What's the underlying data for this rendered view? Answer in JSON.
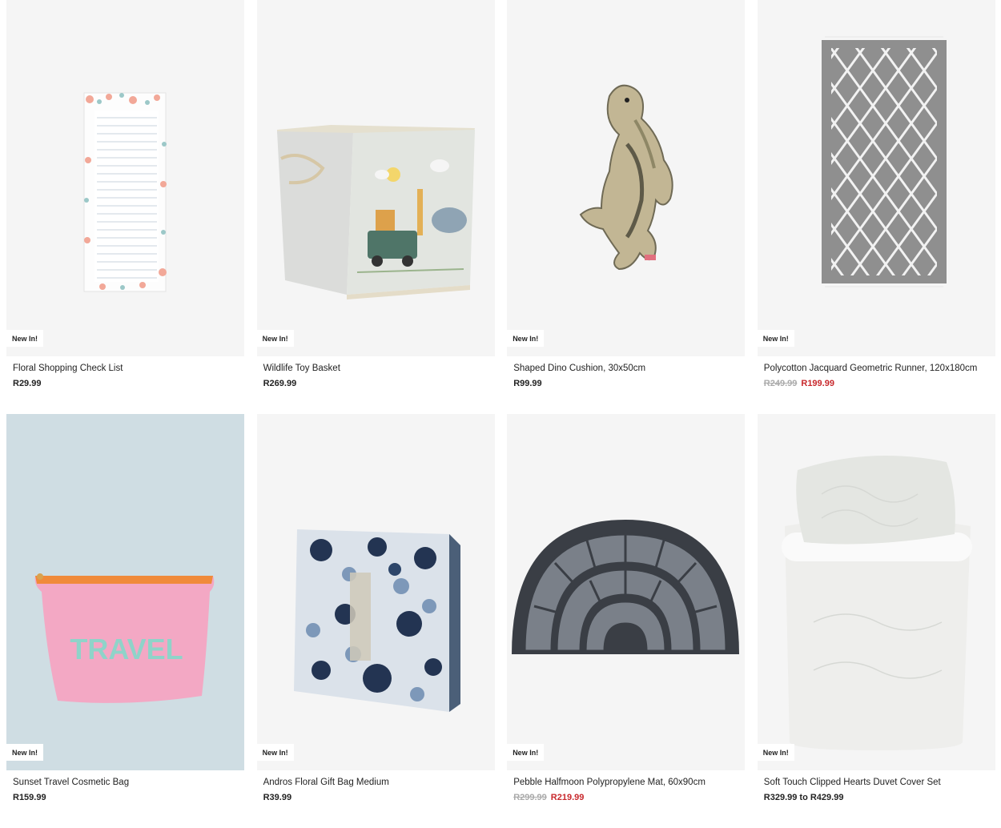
{
  "products": [
    {
      "name": "Floral Shopping Check List",
      "badge": "New In!",
      "price": "R29.99",
      "was": "",
      "now": "",
      "image": "floral-checklist-image",
      "bg": "#f5f5f5"
    },
    {
      "name": "Wildlife Toy Basket",
      "badge": "New In!",
      "price": "R269.99",
      "was": "",
      "now": "",
      "image": "toy-basket-image",
      "bg": "#f5f5f5"
    },
    {
      "name": "Shaped Dino Cushion, 30x50cm",
      "badge": "New In!",
      "price": "R99.99",
      "was": "",
      "now": "",
      "image": "dino-cushion-image",
      "bg": "#f5f5f5"
    },
    {
      "name": "Polycotton Jacquard Geometric Runner, 120x180cm",
      "badge": "New In!",
      "price": "",
      "was": "R249.99",
      "now": "R199.99",
      "image": "geometric-runner-image",
      "bg": "#f5f5f5"
    },
    {
      "name": "Sunset Travel Cosmetic Bag",
      "badge": "New In!",
      "price": "R159.99",
      "was": "",
      "now": "",
      "image": "cosmetic-bag-image",
      "bg": "#cfdde3",
      "print_text": "TRAVEL"
    },
    {
      "name": "Andros Floral Gift Bag Medium",
      "badge": "New In!",
      "price": "R39.99",
      "was": "",
      "now": "",
      "image": "gift-bag-image",
      "bg": "#f5f5f5"
    },
    {
      "name": "Pebble Halfmoon Polypropylene Mat, 60x90cm",
      "badge": "New In!",
      "price": "",
      "was": "R299.99",
      "now": "R219.99",
      "image": "halfmoon-mat-image",
      "bg": "#f5f5f5"
    },
    {
      "name": "Soft Touch Clipped Hearts Duvet Cover Set",
      "badge": "New In!",
      "price": "R329.99 to R429.99",
      "was": "",
      "now": "",
      "image": "duvet-set-image",
      "bg": "#f5f5f5"
    }
  ]
}
